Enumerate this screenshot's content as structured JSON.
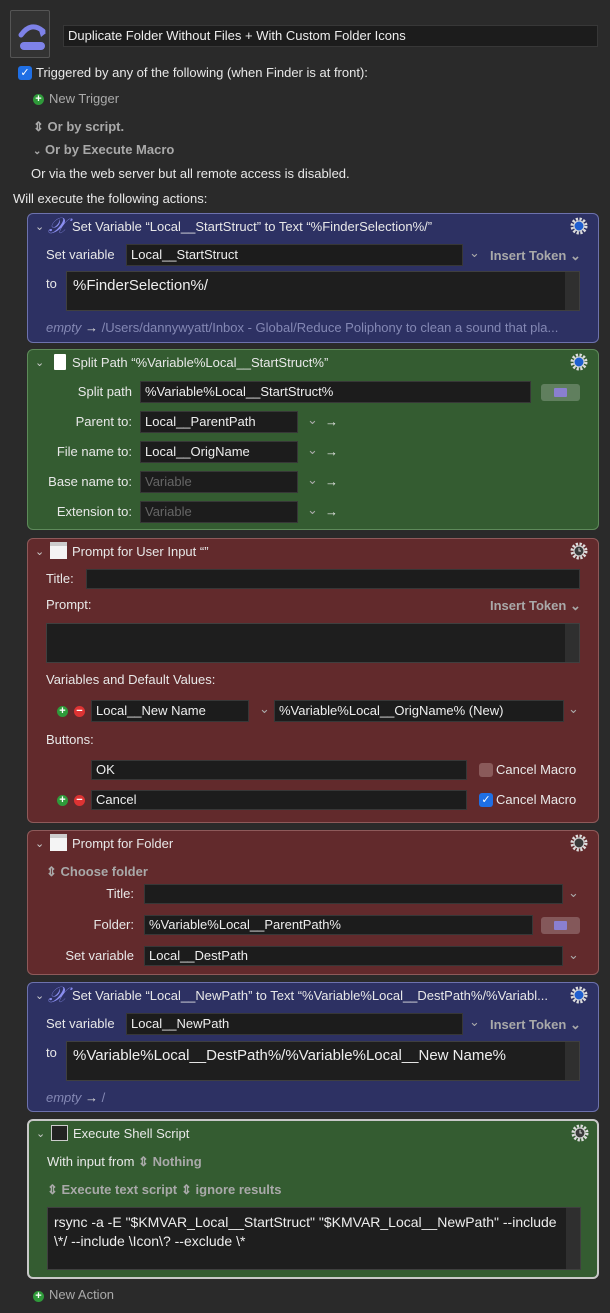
{
  "macro": {
    "title": "Duplicate Folder Without Files + With Custom Folder Icons",
    "icon": "macro-redo-icon"
  },
  "triggers": {
    "enabled": true,
    "label": "Triggered by any of the following (when Finder is at front):",
    "new_trigger": "New Trigger",
    "by_script": "Or by script.",
    "by_execute_macro": "Or by Execute Macro",
    "web_server": "Or via the web server but all remote access is disabled."
  },
  "actions_heading": "Will execute the following actions:",
  "actions": [
    {
      "title": "Set Variable “Local__StartStruct” to Text “%FinderSelection%/”",
      "set_variable_label": "Set variable",
      "variable": "Local__StartStruct",
      "insert_token": "Insert Token",
      "to_label": "to",
      "text": "%FinderSelection%/",
      "preview_empty": "empty",
      "preview": "/Users/dannywyatt/Inbox - Global/Reduce Poliphony to clean a sound that pla..."
    },
    {
      "title": "Split Path “%Variable%Local__StartStruct%”",
      "split_path_label": "Split path",
      "split_path": "%Variable%Local__StartStruct%",
      "parent_label": "Parent to:",
      "parent": "Local__ParentPath",
      "file_name_label": "File name to:",
      "file_name": "Local__OrigName",
      "base_name_label": "Base name to:",
      "base_name_placeholder": "Variable",
      "extension_label": "Extension to:",
      "extension_placeholder": "Variable"
    },
    {
      "title": "Prompt for User Input “”",
      "title_label": "Title:",
      "title_value": "",
      "prompt_label": "Prompt:",
      "insert_token": "Insert Token",
      "prompt_value": "",
      "variables_label": "Variables and Default Values:",
      "variable_name": "Local__New Name",
      "variable_default": "%Variable%Local__OrigName% (New)",
      "buttons_label": "Buttons:",
      "buttons": [
        {
          "label": "OK",
          "cancel_macro": false,
          "cancel_label": "Cancel Macro"
        },
        {
          "label": "Cancel",
          "cancel_macro": true,
          "cancel_label": "Cancel Macro"
        }
      ]
    },
    {
      "title": "Prompt for Folder",
      "mode": "Choose folder",
      "title_label": "Title:",
      "title_value": "",
      "folder_label": "Folder:",
      "folder": "%Variable%Local__ParentPath%",
      "set_variable_label": "Set variable",
      "variable": "Local__DestPath"
    },
    {
      "title": "Set Variable “Local__NewPath” to Text “%Variable%Local__DestPath%/%Variabl...",
      "set_variable_label": "Set variable",
      "variable": "Local__NewPath",
      "insert_token": "Insert Token",
      "to_label": "to",
      "text": "%Variable%Local__DestPath%/%Variable%Local__New Name%",
      "preview_empty": "empty",
      "preview": "/"
    },
    {
      "title": "Execute Shell Script",
      "input_label": "With input from",
      "input": "Nothing",
      "execute_mode": "Execute text script",
      "results": "ignore results",
      "script": "rsync -a -E \"$KMVAR_Local__StartStruct\" \"$KMVAR_Local__NewPath\" --include \\*/ --include \\Icon\\? --exclude \\*"
    }
  ],
  "new_action": "New Action",
  "colors": {
    "set_variable": "#2d3163",
    "split_path": "#345c31",
    "prompt": "#622a2c",
    "shell": "#345c31",
    "background": "#2a2a2a",
    "checkbox": "#1f6fe5"
  }
}
